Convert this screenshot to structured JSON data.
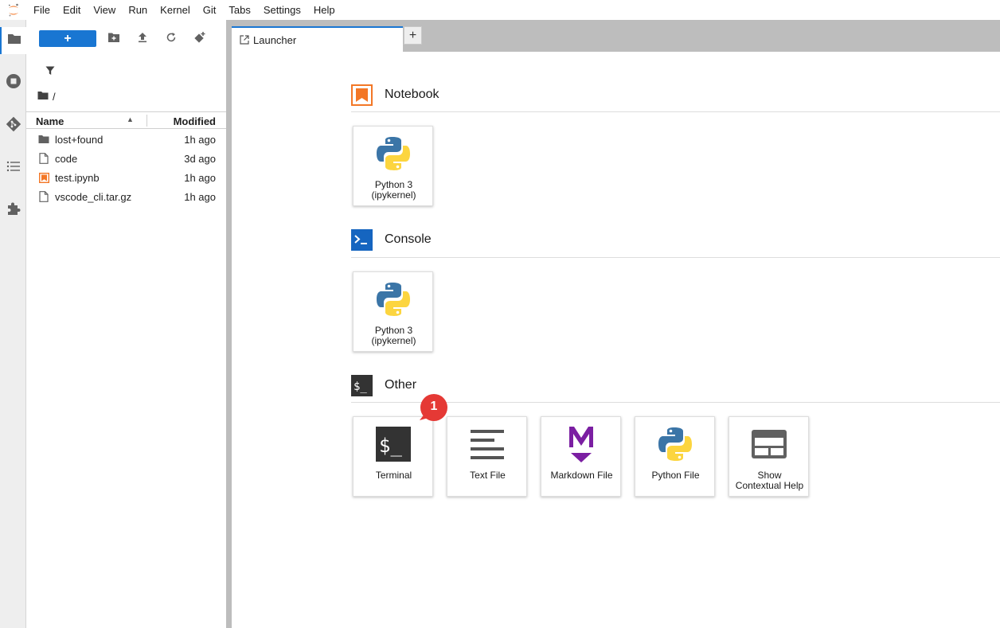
{
  "menubar": {
    "items": [
      "File",
      "Edit",
      "View",
      "Run",
      "Kernel",
      "Git",
      "Tabs",
      "Settings",
      "Help"
    ]
  },
  "activity_bar": {
    "icons": [
      "folder-icon",
      "running-icon",
      "git-icon",
      "toc-icon",
      "extension-icon"
    ]
  },
  "filebrowser": {
    "new_label": "+",
    "breadcrumb": "/",
    "header": {
      "name": "Name",
      "modified": "Modified"
    },
    "files": [
      {
        "name": "lost+found",
        "modified": "1h ago",
        "type": "folder"
      },
      {
        "name": "code",
        "modified": "3d ago",
        "type": "file"
      },
      {
        "name": "test.ipynb",
        "modified": "1h ago",
        "type": "notebook"
      },
      {
        "name": "vscode_cli.tar.gz",
        "modified": "1h ago",
        "type": "file"
      }
    ]
  },
  "tabs": {
    "active": "Launcher",
    "add_label": "+"
  },
  "launcher": {
    "sections": {
      "notebook": "Notebook",
      "console": "Console",
      "other": "Other"
    },
    "notebook_cards": [
      {
        "line1": "Python 3",
        "line2": "(ipykernel)"
      }
    ],
    "console_cards": [
      {
        "line1": "Python 3",
        "line2": "(ipykernel)"
      }
    ],
    "other_cards": [
      {
        "line1": "Terminal",
        "line2": ""
      },
      {
        "line1": "Text File",
        "line2": ""
      },
      {
        "line1": "Markdown File",
        "line2": ""
      },
      {
        "line1": "Python File",
        "line2": ""
      },
      {
        "line1": "Show",
        "line2": "Contextual Help"
      }
    ],
    "badge": "1"
  },
  "colors": {
    "accent": "#1976d2",
    "notebook_orange": "#f37726",
    "console_blue": "#0d47a1",
    "badge_red": "#e53935",
    "markdown_purple": "#7b1fa2"
  }
}
